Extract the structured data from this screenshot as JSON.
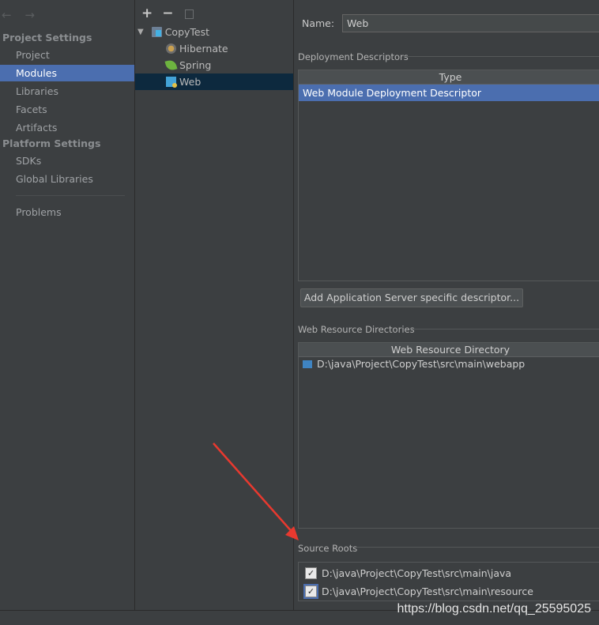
{
  "sidebar": {
    "nav_arrows": "← →",
    "sections": [
      {
        "title": "Project Settings",
        "items": [
          "Project",
          "Modules",
          "Libraries",
          "Facets",
          "Artifacts"
        ]
      },
      {
        "title": "Platform Settings",
        "items": [
          "SDKs",
          "Global Libraries"
        ]
      }
    ],
    "problems": "Problems",
    "selected": "Modules"
  },
  "tree": {
    "toolbar": {
      "add": "+",
      "remove": "−"
    },
    "root": "CopyTest",
    "children": [
      "Hibernate",
      "Spring",
      "Web"
    ],
    "selected": "Web"
  },
  "detail": {
    "name_label": "Name:",
    "name_value": "Web",
    "deployment_title": "Deployment Descriptors",
    "deployment_header": "Type",
    "deployment_rows": [
      "Web Module Deployment Descriptor"
    ],
    "add_button": "Add Application Server specific descriptor...",
    "resources_title": "Web Resource Directories",
    "resources_header": "Web Resource Directory",
    "resources_rows": [
      "D:\\java\\Project\\CopyTest\\src\\main\\webapp"
    ],
    "source_title": "Source Roots",
    "source_roots": [
      {
        "path": "D:\\java\\Project\\CopyTest\\src\\main\\java",
        "checked": true
      },
      {
        "path": "D:\\java\\Project\\CopyTest\\src\\main\\resource",
        "checked": true
      }
    ]
  },
  "watermark": "https://blog.csdn.net/qq_25595025",
  "colors": {
    "selection": "#4b6eaf",
    "tree_selection": "#0d293e",
    "arrow": "#e8392f",
    "background": "#3c3f41"
  }
}
